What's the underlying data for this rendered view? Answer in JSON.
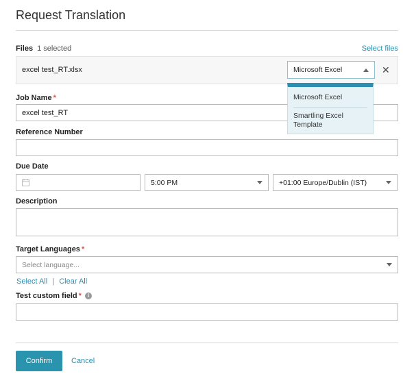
{
  "dialog": {
    "title": "Request Translation"
  },
  "files": {
    "label": "Files",
    "count": "1 selected",
    "select_link": "Select files",
    "file_name": "excel test_RT.xlsx",
    "parser_selected": "Microsoft Excel",
    "parser_options": [
      "Microsoft Excel",
      "Smartling Excel Template"
    ],
    "remove_icon": "close-icon"
  },
  "job_name": {
    "label": "Job Name",
    "required": "*",
    "value": "excel test_RT"
  },
  "reference_number": {
    "label": "Reference Number",
    "value": ""
  },
  "due_date": {
    "label": "Due Date",
    "date_value": "",
    "date_icon": "calendar-icon",
    "time_value": "5:00 PM",
    "timezone_value": "+01:00 Europe/Dublin (IST)"
  },
  "description": {
    "label": "Description",
    "value": ""
  },
  "target_languages": {
    "label": "Target Languages",
    "required": "*",
    "placeholder": "Select language...",
    "select_all": "Select All",
    "separator": "|",
    "clear_all": "Clear All"
  },
  "custom_field": {
    "label": "Test custom field",
    "required": "*",
    "info_icon": "info-icon",
    "value": ""
  },
  "footer": {
    "confirm": "Confirm",
    "cancel": "Cancel"
  },
  "colors": {
    "accent": "#2a93ad",
    "link": "#2a8fb0",
    "required": "#d9534f",
    "dropdown_bg": "#e6f2f6"
  }
}
